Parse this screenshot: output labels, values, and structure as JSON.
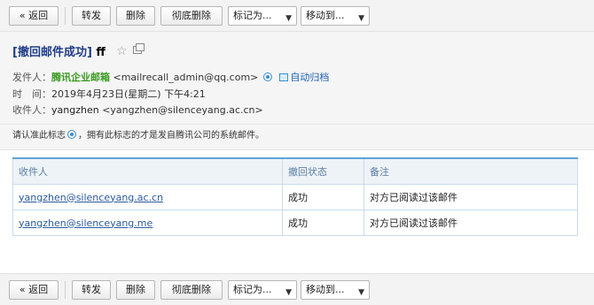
{
  "toolbar": {
    "back": "« 返回",
    "forward": "转发",
    "delete": "删除",
    "purge": "彻底删除",
    "mark_as": "标记为...",
    "move_to": "移动到..."
  },
  "mail": {
    "subject_prefix": "[撤回邮件成功]",
    "subject_rest": "ff",
    "sender_label": "发件人：",
    "sender_name": "腾讯企业邮箱",
    "sender_email": "<mailrecall_admin@qq.com>",
    "auto_archive": "自动归档",
    "time_label": "时　间：",
    "time_value": "2019年4月23日(星期二) 下午4:21",
    "recipient_label": "收件人：",
    "recipient_name": "yangzhen",
    "recipient_email": "<yangzhen@silenceyang.ac.cn>",
    "notice": "请认准此标志",
    "notice_rest": "，拥有此标志的才是发自腾讯公司的系统邮件。"
  },
  "table": {
    "headers": [
      "收件人",
      "撤回状态",
      "备注"
    ],
    "rows": [
      {
        "recipient": "yangzhen@silenceyang.ac.cn",
        "status": "成功",
        "note": "对方已阅读过该邮件"
      },
      {
        "recipient": "yangzhen@silenceyang.me",
        "status": "成功",
        "note": "对方已阅读过该邮件"
      }
    ]
  },
  "icons": {
    "star": "star-icon",
    "popout": "popout-icon",
    "verified": "verified-badge-icon",
    "archive": "archive-icon"
  }
}
